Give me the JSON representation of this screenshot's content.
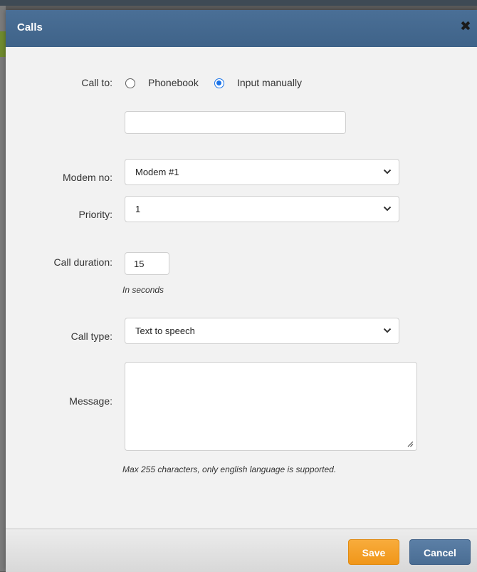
{
  "dialog": {
    "title": "Calls",
    "close_symbol": "✖"
  },
  "call_to": {
    "label": "Call to:",
    "options": [
      {
        "label": "Phonebook",
        "selected": false
      },
      {
        "label": "Input manually",
        "selected": true
      }
    ],
    "manual_number": {
      "value": "",
      "placeholder": ""
    }
  },
  "modem": {
    "label": "Modem no:",
    "selected": "Modem #1"
  },
  "priority": {
    "label": "Priority:",
    "selected": "1"
  },
  "call_duration": {
    "label": "Call duration:",
    "value": "15",
    "hint": "In seconds"
  },
  "call_type": {
    "label": "Call type:",
    "selected": "Text to speech"
  },
  "message": {
    "label": "Message:",
    "value": "",
    "hint": "Max 255 characters, only english language is supported."
  },
  "footer": {
    "save_label": "Save",
    "cancel_label": "Cancel"
  },
  "colors": {
    "titlebar": "#4a6f96",
    "save": "#f5a32a",
    "cancel": "#4f739a",
    "radio_accent": "#1a73e8"
  },
  "icons": {
    "close": "close-icon",
    "dropdown": "chevron-down-icon",
    "resize": "resize-grip-icon"
  }
}
